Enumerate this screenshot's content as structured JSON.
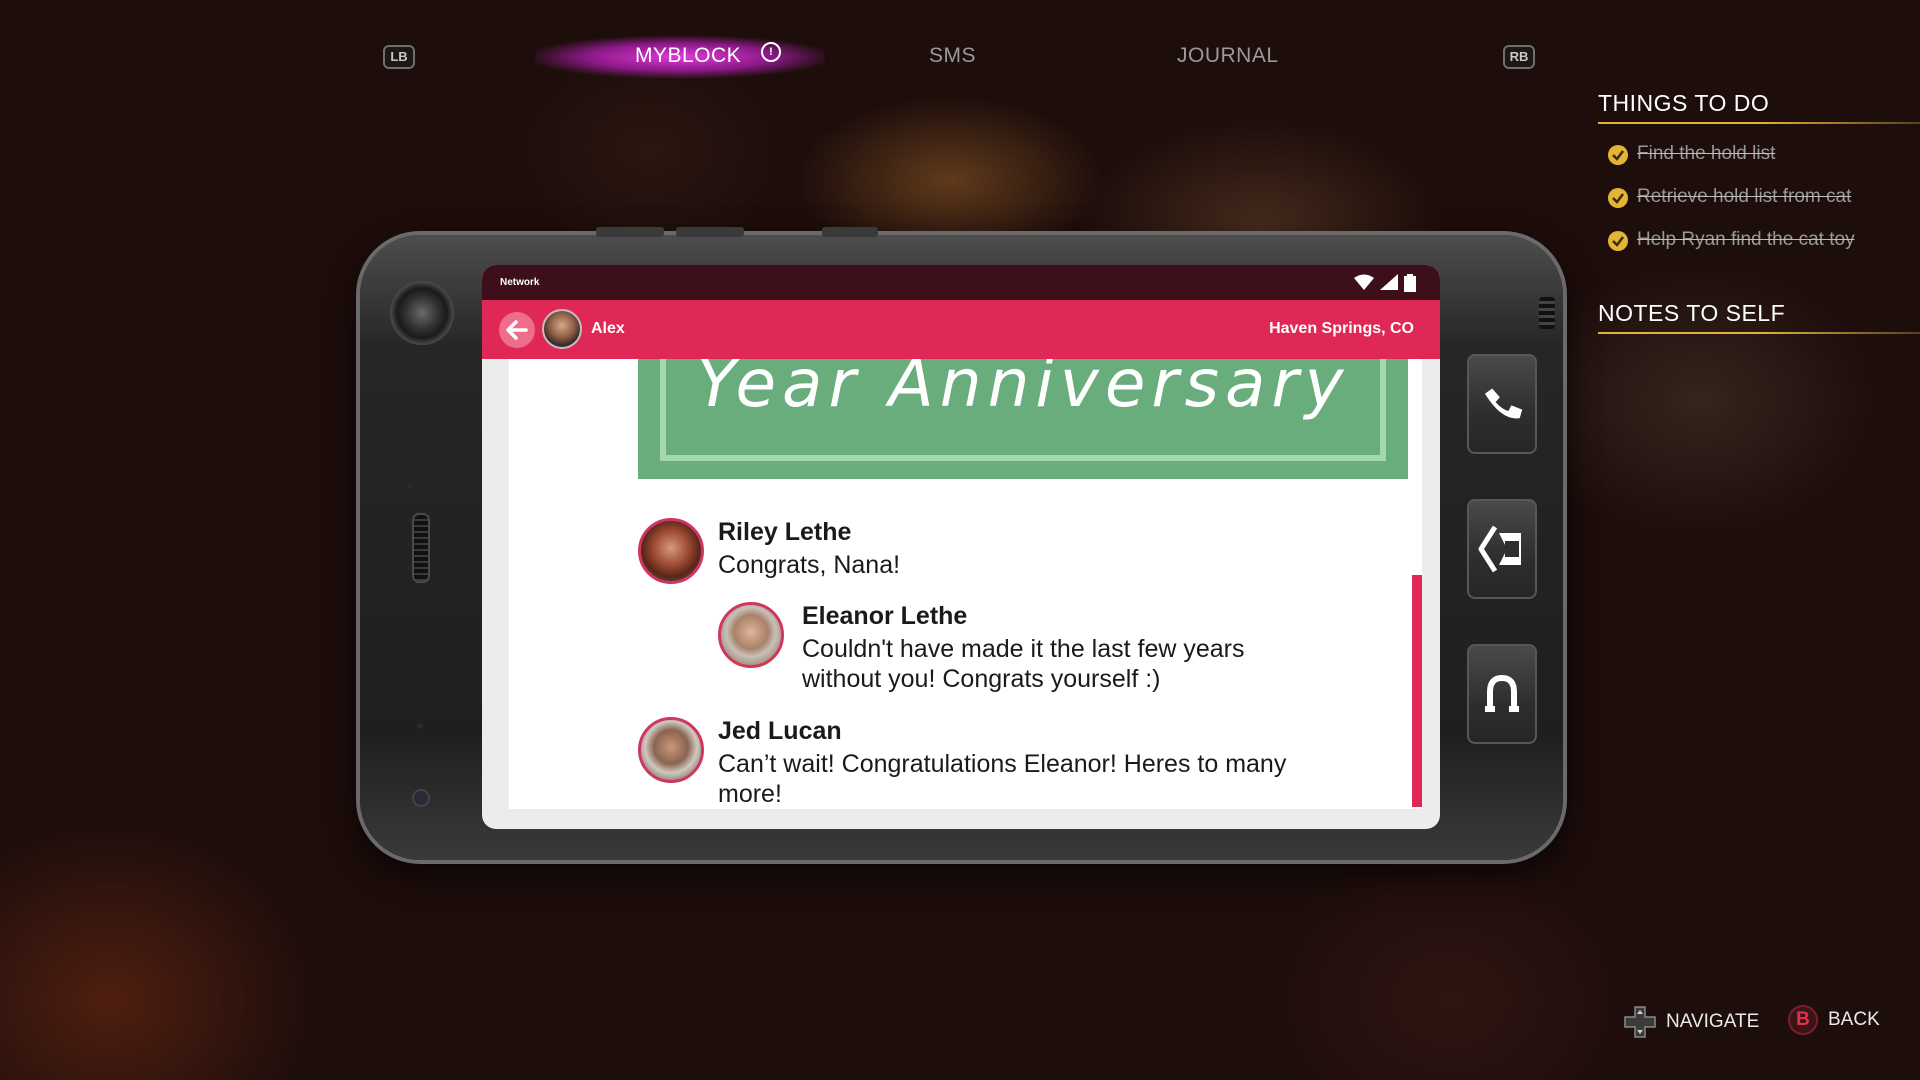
{
  "tabs": {
    "left_bumper": "LB",
    "right_bumper": "RB",
    "items": [
      {
        "label": "MYBLOCK",
        "active": true,
        "alert": "!"
      },
      {
        "label": "SMS",
        "active": false
      },
      {
        "label": "JOURNAL",
        "active": false
      }
    ]
  },
  "phone": {
    "status": {
      "network": "Network"
    },
    "app_bar": {
      "contact": "Alex",
      "location": "Haven Springs, CO"
    },
    "post": {
      "banner_text": "Year Anniversary"
    },
    "comments": [
      {
        "name": "Riley Lethe",
        "text": "Congrats, Nana!"
      },
      {
        "name": "Eleanor Lethe",
        "text": "Couldn't have made it the last few years without you! Congrats yourself :)"
      },
      {
        "name": "Jed Lucan",
        "text": "Can’t wait! Congratulations Eleanor! Heres to many more!"
      }
    ]
  },
  "sidebar": {
    "things_to_do_heading": "THINGS TO DO",
    "tasks": [
      {
        "label": "Find the hold list",
        "done": true
      },
      {
        "label": "Retrieve hold list from cat",
        "done": true
      },
      {
        "label": "Help Ryan find the cat toy",
        "done": true
      }
    ],
    "notes_heading": "NOTES TO SELF"
  },
  "footer": {
    "navigate_label": "NAVIGATE",
    "back_button_glyph": "B",
    "back_label": "BACK"
  },
  "colors": {
    "accent_pink": "#df2855",
    "tab_glow": "#d83ad8",
    "banner_green": "#68ad7b",
    "check_gold": "#e3b534"
  },
  "icons": {
    "phone_side_buttons": [
      "phone-call-icon",
      "exit-door-icon",
      "magnet-icon"
    ],
    "status": [
      "wifi-icon",
      "signal-icon",
      "battery-icon"
    ]
  }
}
